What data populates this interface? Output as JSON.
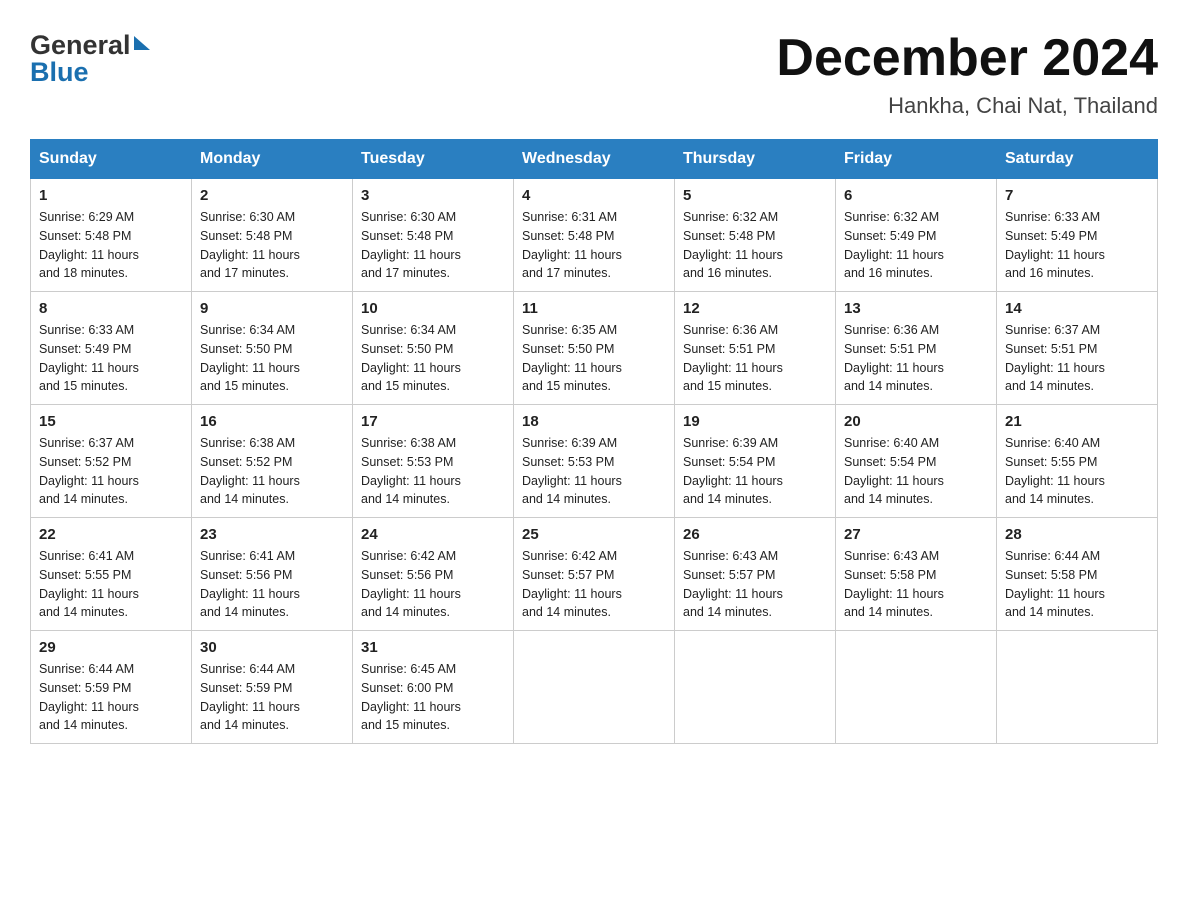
{
  "header": {
    "logo_general": "General",
    "logo_blue": "Blue",
    "title": "December 2024",
    "subtitle": "Hankha, Chai Nat, Thailand"
  },
  "days_of_week": [
    "Sunday",
    "Monday",
    "Tuesday",
    "Wednesday",
    "Thursday",
    "Friday",
    "Saturday"
  ],
  "weeks": [
    [
      {
        "day": "1",
        "info": "Sunrise: 6:29 AM\nSunset: 5:48 PM\nDaylight: 11 hours\nand 18 minutes."
      },
      {
        "day": "2",
        "info": "Sunrise: 6:30 AM\nSunset: 5:48 PM\nDaylight: 11 hours\nand 17 minutes."
      },
      {
        "day": "3",
        "info": "Sunrise: 6:30 AM\nSunset: 5:48 PM\nDaylight: 11 hours\nand 17 minutes."
      },
      {
        "day": "4",
        "info": "Sunrise: 6:31 AM\nSunset: 5:48 PM\nDaylight: 11 hours\nand 17 minutes."
      },
      {
        "day": "5",
        "info": "Sunrise: 6:32 AM\nSunset: 5:48 PM\nDaylight: 11 hours\nand 16 minutes."
      },
      {
        "day": "6",
        "info": "Sunrise: 6:32 AM\nSunset: 5:49 PM\nDaylight: 11 hours\nand 16 minutes."
      },
      {
        "day": "7",
        "info": "Sunrise: 6:33 AM\nSunset: 5:49 PM\nDaylight: 11 hours\nand 16 minutes."
      }
    ],
    [
      {
        "day": "8",
        "info": "Sunrise: 6:33 AM\nSunset: 5:49 PM\nDaylight: 11 hours\nand 15 minutes."
      },
      {
        "day": "9",
        "info": "Sunrise: 6:34 AM\nSunset: 5:50 PM\nDaylight: 11 hours\nand 15 minutes."
      },
      {
        "day": "10",
        "info": "Sunrise: 6:34 AM\nSunset: 5:50 PM\nDaylight: 11 hours\nand 15 minutes."
      },
      {
        "day": "11",
        "info": "Sunrise: 6:35 AM\nSunset: 5:50 PM\nDaylight: 11 hours\nand 15 minutes."
      },
      {
        "day": "12",
        "info": "Sunrise: 6:36 AM\nSunset: 5:51 PM\nDaylight: 11 hours\nand 15 minutes."
      },
      {
        "day": "13",
        "info": "Sunrise: 6:36 AM\nSunset: 5:51 PM\nDaylight: 11 hours\nand 14 minutes."
      },
      {
        "day": "14",
        "info": "Sunrise: 6:37 AM\nSunset: 5:51 PM\nDaylight: 11 hours\nand 14 minutes."
      }
    ],
    [
      {
        "day": "15",
        "info": "Sunrise: 6:37 AM\nSunset: 5:52 PM\nDaylight: 11 hours\nand 14 minutes."
      },
      {
        "day": "16",
        "info": "Sunrise: 6:38 AM\nSunset: 5:52 PM\nDaylight: 11 hours\nand 14 minutes."
      },
      {
        "day": "17",
        "info": "Sunrise: 6:38 AM\nSunset: 5:53 PM\nDaylight: 11 hours\nand 14 minutes."
      },
      {
        "day": "18",
        "info": "Sunrise: 6:39 AM\nSunset: 5:53 PM\nDaylight: 11 hours\nand 14 minutes."
      },
      {
        "day": "19",
        "info": "Sunrise: 6:39 AM\nSunset: 5:54 PM\nDaylight: 11 hours\nand 14 minutes."
      },
      {
        "day": "20",
        "info": "Sunrise: 6:40 AM\nSunset: 5:54 PM\nDaylight: 11 hours\nand 14 minutes."
      },
      {
        "day": "21",
        "info": "Sunrise: 6:40 AM\nSunset: 5:55 PM\nDaylight: 11 hours\nand 14 minutes."
      }
    ],
    [
      {
        "day": "22",
        "info": "Sunrise: 6:41 AM\nSunset: 5:55 PM\nDaylight: 11 hours\nand 14 minutes."
      },
      {
        "day": "23",
        "info": "Sunrise: 6:41 AM\nSunset: 5:56 PM\nDaylight: 11 hours\nand 14 minutes."
      },
      {
        "day": "24",
        "info": "Sunrise: 6:42 AM\nSunset: 5:56 PM\nDaylight: 11 hours\nand 14 minutes."
      },
      {
        "day": "25",
        "info": "Sunrise: 6:42 AM\nSunset: 5:57 PM\nDaylight: 11 hours\nand 14 minutes."
      },
      {
        "day": "26",
        "info": "Sunrise: 6:43 AM\nSunset: 5:57 PM\nDaylight: 11 hours\nand 14 minutes."
      },
      {
        "day": "27",
        "info": "Sunrise: 6:43 AM\nSunset: 5:58 PM\nDaylight: 11 hours\nand 14 minutes."
      },
      {
        "day": "28",
        "info": "Sunrise: 6:44 AM\nSunset: 5:58 PM\nDaylight: 11 hours\nand 14 minutes."
      }
    ],
    [
      {
        "day": "29",
        "info": "Sunrise: 6:44 AM\nSunset: 5:59 PM\nDaylight: 11 hours\nand 14 minutes."
      },
      {
        "day": "30",
        "info": "Sunrise: 6:44 AM\nSunset: 5:59 PM\nDaylight: 11 hours\nand 14 minutes."
      },
      {
        "day": "31",
        "info": "Sunrise: 6:45 AM\nSunset: 6:00 PM\nDaylight: 11 hours\nand 15 minutes."
      },
      {
        "day": "",
        "info": ""
      },
      {
        "day": "",
        "info": ""
      },
      {
        "day": "",
        "info": ""
      },
      {
        "day": "",
        "info": ""
      }
    ]
  ]
}
